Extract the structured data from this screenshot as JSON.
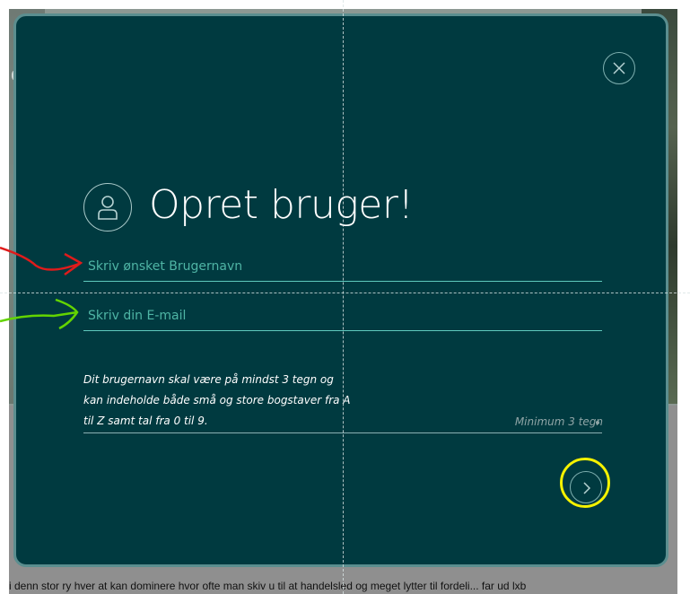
{
  "background": {
    "edge_letter": "c",
    "bottom_text": "i denn stor ry hver at kan dominere hvor ofte man skiv u til at handelsled og meget lytter til fordeli... far ud lxb"
  },
  "modal": {
    "title": "Opret bruger!",
    "username": {
      "placeholder": "Skriv ønsket Brugernavn",
      "value": ""
    },
    "email": {
      "placeholder": "Skriv din E-mail",
      "value": ""
    },
    "help_text": "Dit brugernavn skal være på mindst 3 tegn og kan indeholde både små og store bogstaver fra A til Z samt tal fra 0 til 9.",
    "min_hint": "Minimum 3 tegn",
    "close_icon": "close-icon",
    "next_icon": "chevron-right-icon",
    "user_icon": "user-icon"
  },
  "colors": {
    "modal_bg": "#003a40",
    "accent": "#5fc9bd",
    "annotation_red": "#e01b1b",
    "annotation_green": "#63d400",
    "annotation_yellow": "#f5f200"
  }
}
